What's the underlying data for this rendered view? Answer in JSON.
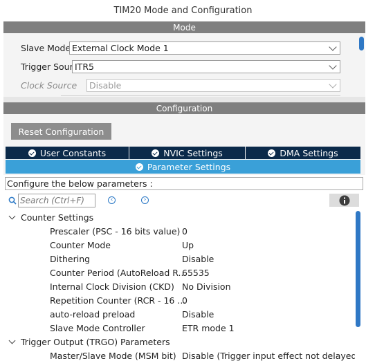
{
  "window": {
    "title": "TIM20 Mode and Configuration"
  },
  "mode": {
    "header": "Mode",
    "fields": [
      {
        "label": "Slave Mode",
        "value": "External Clock Mode 1",
        "enabled": true
      },
      {
        "label": "Trigger Source",
        "value": "ITR5",
        "enabled": true
      },
      {
        "label": "Clock Source",
        "value": "Disable",
        "enabled": false
      }
    ]
  },
  "configuration": {
    "header": "Configuration",
    "reset_label": "Reset Configuration",
    "tabs": [
      {
        "label": "User Constants"
      },
      {
        "label": "NVIC Settings"
      },
      {
        "label": "DMA Settings"
      }
    ],
    "active_tab": {
      "label": "Parameter Settings"
    },
    "instructions": "Configure the below parameters :",
    "search": {
      "placeholder": "Search (Ctrl+F)"
    },
    "groups": [
      {
        "name": "Counter Settings",
        "params": [
          {
            "name": "Prescaler (PSC - 16 bits value)",
            "value": "0"
          },
          {
            "name": "Counter Mode",
            "value": "Up"
          },
          {
            "name": "Dithering",
            "value": "Disable"
          },
          {
            "name": "Counter Period (AutoReload R...",
            "value": "65535"
          },
          {
            "name": "Internal Clock Division (CKD)",
            "value": "No Division"
          },
          {
            "name": "Repetition Counter (RCR - 16 ...",
            "value": "0"
          },
          {
            "name": "auto-reload preload",
            "value": "Disable"
          },
          {
            "name": "Slave Mode Controller",
            "value": "ETR mode 1"
          }
        ]
      },
      {
        "name": "Trigger Output (TRGO) Parameters",
        "params": [
          {
            "name": "Master/Slave Mode (MSM bit)",
            "value": "Disable (Trigger input effect not delayed)"
          }
        ]
      }
    ]
  },
  "colors": {
    "tab_dark": "#0b2a4a",
    "tab_active": "#3aa0d8",
    "scroll": "#2f78c5",
    "header_bar": "#7f7f7f"
  }
}
